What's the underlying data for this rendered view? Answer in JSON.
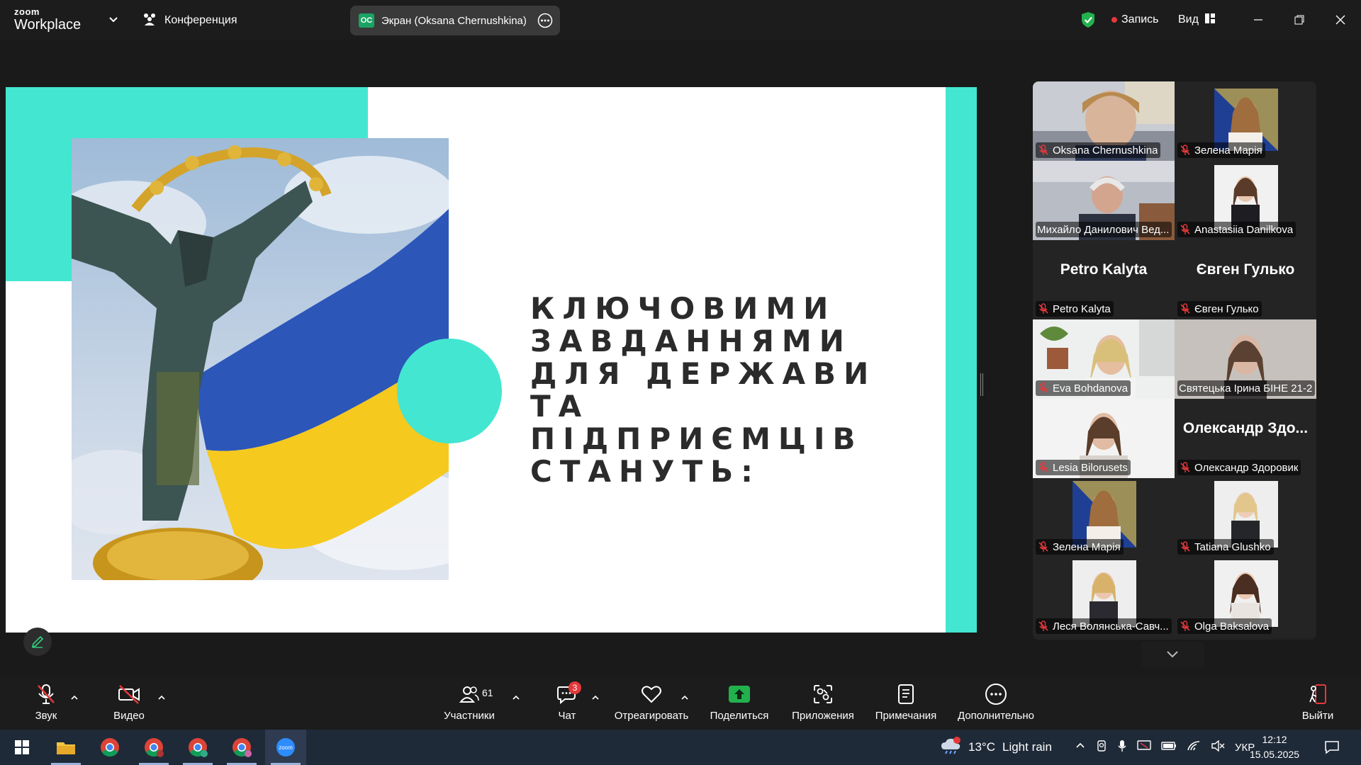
{
  "titlebar": {
    "logo_top": "zoom",
    "logo_bottom": "Workplace",
    "conference_label": "Конференция",
    "screen_badge": "OC",
    "screen_label": "Экран (Oksana Chernushkina)",
    "record_label": "Запись",
    "view_label": "Вид"
  },
  "slide": {
    "heading_lines": [
      "КЛЮЧОВИМИ",
      "ЗАВДАННЯМИ",
      "ДЛЯ ДЕРЖАВИ ТА",
      "ПІДПРИЄМЦІВ",
      "СТАНУТЬ:"
    ],
    "accent_color": "#43e6d0"
  },
  "participants": [
    {
      "name": "Oksana Chernushkina",
      "type": "video"
    },
    {
      "name": "Зелена Марія",
      "type": "video"
    },
    {
      "name": "Михайло Данилович Вед...",
      "type": "video"
    },
    {
      "name": "Anastasiia Danilkova",
      "type": "video"
    },
    {
      "name": "Petro Kalyta",
      "display": "Petro Kalyta",
      "type": "name"
    },
    {
      "name": "Євген Гулько",
      "display": "Євген Гулько",
      "type": "name"
    },
    {
      "name": "Eva Bohdanova",
      "type": "video"
    },
    {
      "name": "Святецька Ірина БІНЕ 21-2",
      "type": "video",
      "active": true
    },
    {
      "name": "Lesia Bilorusets",
      "type": "video"
    },
    {
      "name": "Олександр Здоровик",
      "display": "Олександр Здо...",
      "type": "name"
    },
    {
      "name": "Зелена Марія",
      "type": "video"
    },
    {
      "name": "Tatiana Glushko",
      "type": "video"
    },
    {
      "name": "Леся Волянська-Савч...",
      "type": "video"
    },
    {
      "name": "Olga Baksalova",
      "type": "video"
    }
  ],
  "toolbar": {
    "audio": "Звук",
    "video": "Видео",
    "participants": "Участники",
    "participants_count": "61",
    "chat": "Чат",
    "chat_badge": "3",
    "react": "Отреагировать",
    "share": "Поделиться",
    "apps": "Приложения",
    "notes": "Примечания",
    "more": "Дополнительно",
    "leave": "Выйти"
  },
  "taskbar": {
    "weather_temp": "13°C",
    "weather_desc": "Light rain",
    "lang": "УКР",
    "time": "12:12",
    "date": "15.05.2025"
  }
}
